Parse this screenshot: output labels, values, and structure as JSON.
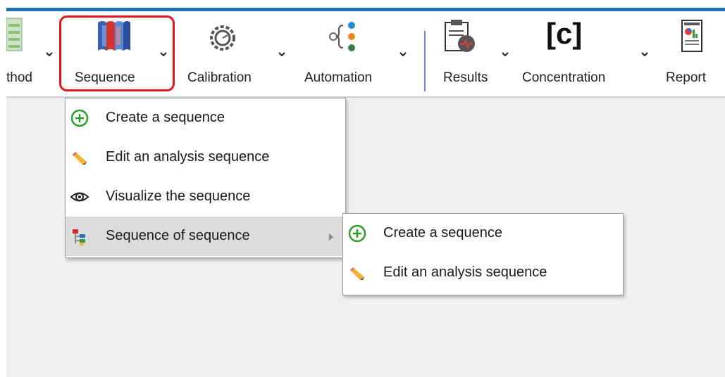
{
  "ribbon": {
    "items": [
      {
        "label": "thod",
        "icon": "method-icon"
      },
      {
        "label": "Sequence",
        "icon": "sequence-icon"
      },
      {
        "label": "Calibration",
        "icon": "calibration-icon"
      },
      {
        "label": "Automation",
        "icon": "automation-icon"
      },
      {
        "label": "Results",
        "icon": "results-icon"
      },
      {
        "label": "Concentration",
        "icon": "concentration-icon",
        "glyph": "[c]"
      },
      {
        "label": "Report",
        "icon": "report-icon"
      }
    ]
  },
  "sequence_menu": {
    "items": [
      {
        "label": "Create a sequence",
        "icon": "plus-circle-icon"
      },
      {
        "label": "Edit an analysis sequence",
        "icon": "pencil-icon"
      },
      {
        "label": "Visualize the sequence",
        "icon": "eye-icon"
      },
      {
        "label": "Sequence of sequence",
        "icon": "sequence-tree-icon",
        "has_submenu": true
      }
    ]
  },
  "submenu": {
    "items": [
      {
        "label": "Create a sequence",
        "icon": "plus-circle-icon"
      },
      {
        "label": "Edit an analysis sequence",
        "icon": "pencil-icon"
      }
    ]
  },
  "colors": {
    "accent": "#1f6fb2",
    "highlight": "#e8141c",
    "plus": "#2a9d2a"
  }
}
